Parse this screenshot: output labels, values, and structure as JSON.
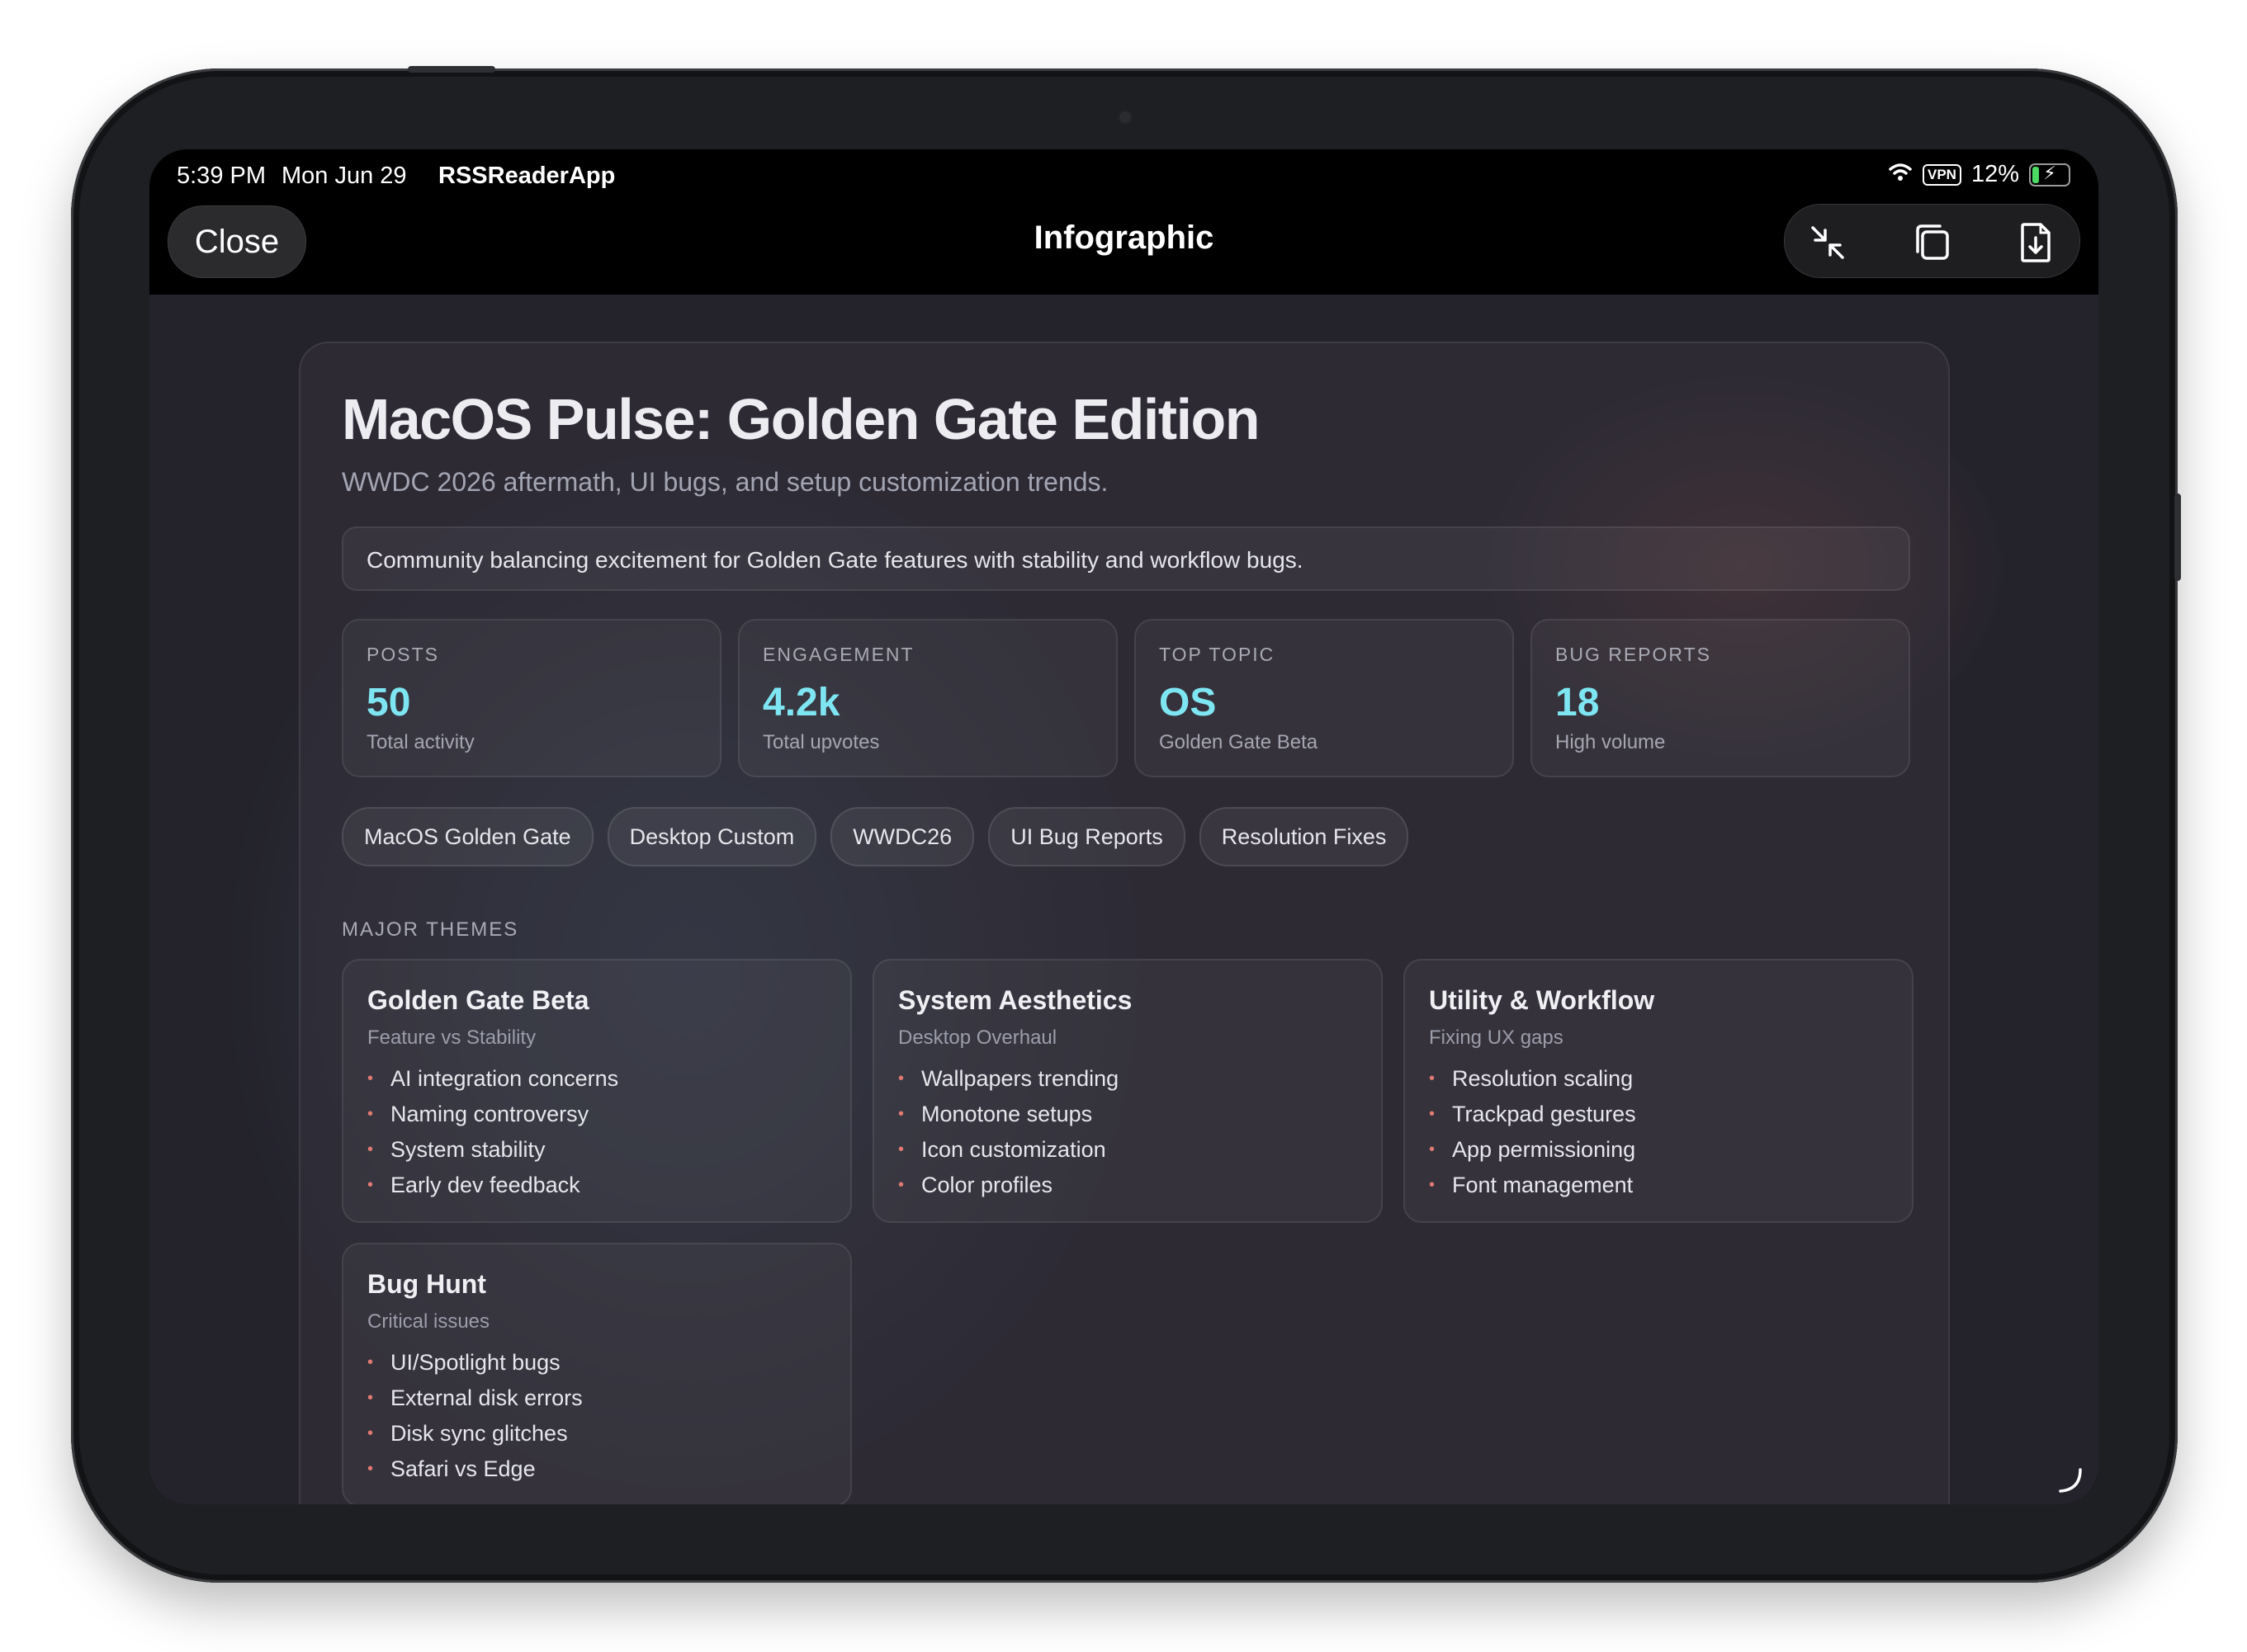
{
  "status_bar": {
    "time": "5:39 PM",
    "date": "Mon Jun 29",
    "app_name": "RSSReaderApp",
    "vpn": "VPN",
    "battery": "12%"
  },
  "nav": {
    "close_label": "Close",
    "title": "Infographic",
    "icons": [
      "collapse-arrows-icon",
      "copy-icon",
      "export-document-icon"
    ]
  },
  "infographic": {
    "title": "MacOS Pulse: Golden Gate Edition",
    "subtitle": "WWDC 2026 aftermath, UI bugs, and setup customization trends.",
    "summary": "Community balancing excitement for Golden Gate features with stability and workflow bugs.",
    "stats": [
      {
        "label": "POSTS",
        "value": "50",
        "sub": "Total activity"
      },
      {
        "label": "ENGAGEMENT",
        "value": "4.2k",
        "sub": "Total upvotes"
      },
      {
        "label": "TOP TOPIC",
        "value": "OS",
        "sub": "Golden Gate Beta"
      },
      {
        "label": "BUG REPORTS",
        "value": "18",
        "sub": "High volume"
      }
    ],
    "tags": [
      "MacOS Golden Gate",
      "Desktop Custom",
      "WWDC26",
      "UI Bug Reports",
      "Resolution Fixes"
    ],
    "themes_label": "MAJOR THEMES",
    "themes": [
      {
        "title": "Golden Gate Beta",
        "sub": "Feature vs Stability",
        "items": [
          "AI integration concerns",
          "Naming controversy",
          "System stability",
          "Early dev feedback"
        ]
      },
      {
        "title": "System Aesthetics",
        "sub": "Desktop Overhaul",
        "items": [
          "Wallpapers trending",
          "Monotone setups",
          "Icon customization",
          "Color profiles"
        ]
      },
      {
        "title": "Utility & Workflow",
        "sub": "Fixing UX gaps",
        "items": [
          "Resolution scaling",
          "Trackpad gestures",
          "App permissioning",
          "Font management"
        ]
      },
      {
        "title": "Bug Hunt",
        "sub": "Critical issues",
        "items": [
          "UI/Spotlight bugs",
          "External disk errors",
          "Disk sync glitches",
          "Safari vs Edge"
        ]
      }
    ]
  },
  "colors": {
    "accent": "#7ee6f2",
    "bullet": "#e07a72",
    "background": "#24232c"
  }
}
